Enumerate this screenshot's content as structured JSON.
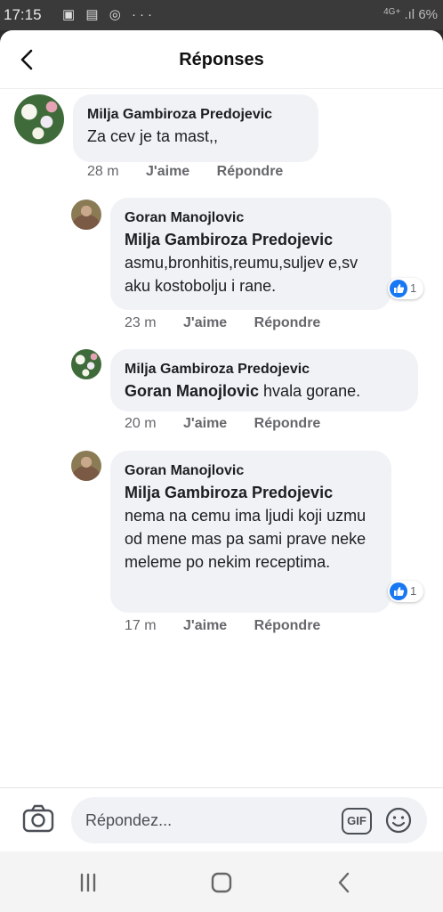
{
  "status_bar": {
    "time": "17:15",
    "icons": [
      "image-icon",
      "facebook-icon",
      "messenger-icon",
      "more-icon"
    ],
    "network": "4G+",
    "battery": "6%"
  },
  "header": {
    "title": "Réponses",
    "back_icon": "chevron-left-icon"
  },
  "comments": [
    {
      "author": "Milja Gambiroza Predojevic",
      "mention": "",
      "text": "Za cev je ta mast,,",
      "time": "28 m",
      "like_label": "J'aime",
      "reply_label": "Répondre",
      "reaction_count": ""
    },
    {
      "author": "Goran Manojlovic",
      "mention": "Milja Gambiroza Predojevic",
      "text": "asmu,bronhitis,reumu,suljev e,svaku kostobolju i rane.",
      "time": "23 m",
      "like_label": "J'aime",
      "reply_label": "Répondre",
      "reaction_count": "1"
    },
    {
      "author": "Milja Gambiroza Predojevic",
      "mention": "Goran Manojlovic",
      "text": "hvala gorane.",
      "time": "20 m",
      "like_label": "J'aime",
      "reply_label": "Répondre",
      "reaction_count": ""
    },
    {
      "author": "Goran Manojlovic",
      "mention": "Milja Gambiroza Predojevic",
      "text": "nema na cemu ima ljudi koji uzmu od mene mas pa sami prave neke meleme po nekim receptima.",
      "time": "17 m",
      "like_label": "J'aime",
      "reply_label": "Répondre",
      "reaction_count": "1"
    }
  ],
  "composer": {
    "placeholder": "Répondez...",
    "gif_label": "GIF",
    "camera_icon": "camera-icon",
    "emoji_icon": "emoji-icon"
  },
  "nav_bar": {
    "icons": [
      "recent-apps-icon",
      "home-icon",
      "back-icon"
    ]
  },
  "colors": {
    "bubble_bg": "#f0f2f5",
    "meta_text": "#65676b",
    "like_blue": "#1877f2"
  }
}
